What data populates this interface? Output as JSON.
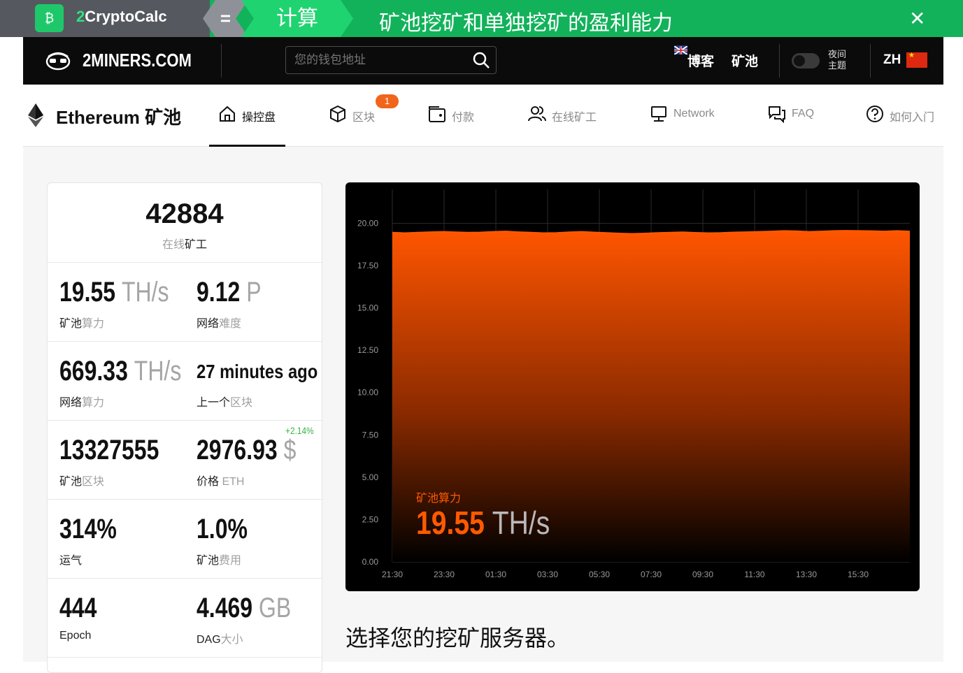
{
  "banner": {
    "brand_prefix": "2",
    "brand_name": "CryptoCalc",
    "equals": "=",
    "calc": "计算",
    "title": "矿池挖矿和单独挖矿的盈利能力",
    "close": "✕",
    "accent": "#12b25a"
  },
  "header": {
    "logo_text": "2MINERS.COM",
    "search_placeholder": "您的钱包地址",
    "nav_blog": "博客",
    "nav_pools": "矿池",
    "night_line1": "夜间",
    "night_line2": "主题",
    "lang": "ZH"
  },
  "pool": {
    "title": "Ethereum 矿池",
    "tabs": [
      {
        "label": "操控盘",
        "icon": "home-icon"
      },
      {
        "label": "区块",
        "icon": "cube-icon",
        "badge": "1"
      },
      {
        "label": "付款",
        "icon": "wallet-icon"
      },
      {
        "label": "在线矿工",
        "icon": "users-icon"
      },
      {
        "label": "Network",
        "icon": "monitor-icon"
      },
      {
        "label": "FAQ",
        "icon": "chat-icon"
      },
      {
        "label": "如何入门",
        "icon": "question-icon"
      }
    ]
  },
  "stats": {
    "online_miners": "42884",
    "online_miners_caption_gray": "在线",
    "online_miners_caption_dark": "矿工",
    "pool_hashrate": "19.55",
    "pool_hashrate_unit": "TH/s",
    "pool_hashrate_cap_dark": "矿池",
    "pool_hashrate_cap_gray": "算力",
    "net_difficulty": "9.12",
    "net_difficulty_unit": "P",
    "net_difficulty_cap_dark": "网络",
    "net_difficulty_cap_gray": "难度",
    "net_hashrate": "669.33",
    "net_hashrate_unit": "TH/s",
    "net_hashrate_cap_dark": "网络",
    "net_hashrate_cap_gray": "算力",
    "last_block": "27 minutes ago",
    "last_block_cap_dark": "上一个",
    "last_block_cap_gray": "区块",
    "pool_blocks": "13327555",
    "pool_blocks_cap_dark": "矿池",
    "pool_blocks_cap_gray": "区块",
    "price": "2976.93",
    "price_unit": "$",
    "price_change": "+2.14%",
    "price_cap_dark": "价格",
    "price_cap_gray": "ETH",
    "luck": "314%",
    "luck_cap": "运气",
    "fee": "1.0%",
    "fee_cap_dark": "矿池",
    "fee_cap_gray": "费用",
    "epoch": "444",
    "epoch_cap": "Epoch",
    "dag": "4.469",
    "dag_unit": "GB",
    "dag_cap_dark": "DAG",
    "dag_cap_gray": "大小"
  },
  "chart_data": {
    "type": "area",
    "ylim": [
      0,
      22
    ],
    "yticks": [
      "0.00",
      "2.50",
      "5.00",
      "7.50",
      "10.00",
      "12.50",
      "15.00",
      "17.50",
      "20.00"
    ],
    "xticks": [
      "21:30",
      "23:30",
      "01:30",
      "03:30",
      "05:30",
      "07:30",
      "09:30",
      "11:30",
      "13:30",
      "15:30"
    ],
    "series": [
      {
        "values": [
          19.45,
          19.42,
          19.45,
          19.48,
          19.5,
          19.47,
          19.45,
          19.46,
          19.5,
          19.52,
          19.48,
          19.45,
          19.42,
          19.43,
          19.47,
          19.5,
          19.46,
          19.43,
          19.4,
          19.38,
          19.4,
          19.43,
          19.45,
          19.47,
          19.44,
          19.42,
          19.43,
          19.46,
          19.48,
          19.5,
          19.52,
          19.55,
          19.53,
          19.5,
          19.52,
          19.55,
          19.56,
          19.55,
          19.54,
          19.52,
          19.55,
          19.52
        ]
      }
    ],
    "label": "矿池算力",
    "value": "19.55",
    "unit": "TH/s",
    "grid": true,
    "color": "#ff5a00"
  },
  "section": {
    "heading": "选择您的挖矿服务器。"
  }
}
